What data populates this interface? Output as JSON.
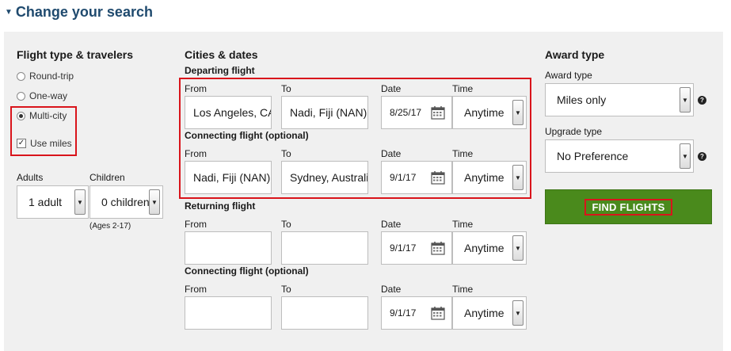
{
  "header": {
    "title": "Change your search"
  },
  "flight_type": {
    "title": "Flight type & travelers",
    "options": [
      {
        "label": "Round-trip",
        "selected": false
      },
      {
        "label": "One-way",
        "selected": false
      },
      {
        "label": "Multi-city",
        "selected": true
      }
    ],
    "use_miles": {
      "label": "Use miles",
      "checked": true
    }
  },
  "travelers": {
    "adults_label": "Adults",
    "adults_value": "1 adult",
    "children_label": "Children",
    "children_value": "0 children",
    "children_note": "(Ages 2-17)"
  },
  "cities": {
    "title": "Cities & dates",
    "col_from": "From",
    "col_to": "To",
    "col_date": "Date",
    "col_time": "Time",
    "segments": [
      {
        "heading": "Departing flight",
        "from": "Los Angeles, CA",
        "to": "Nadi, Fiji (NAN)",
        "date": "8/25/17",
        "time": "Anytime"
      },
      {
        "heading": "Connecting flight (optional)",
        "from": "Nadi, Fiji (NAN)",
        "to": "Sydney, Australia",
        "date": "9/1/17",
        "time": "Anytime"
      },
      {
        "heading": "Returning flight",
        "from": "",
        "to": "",
        "date": "9/1/17",
        "time": "Anytime"
      },
      {
        "heading": "Connecting flight (optional)",
        "from": "",
        "to": "",
        "date": "9/1/17",
        "time": "Anytime"
      }
    ]
  },
  "award": {
    "title": "Award type",
    "award_type_label": "Award type",
    "award_type_value": "Miles only",
    "upgrade_label": "Upgrade type",
    "upgrade_value": "No Preference",
    "find_button": "FIND FLIGHTS",
    "help_glyph": "?"
  },
  "icons": {
    "collapse": "triangle-down-icon",
    "calendar": "calendar-icon",
    "dropdown": "chevron-down-icon",
    "help": "question-icon"
  },
  "colors": {
    "title": "#1f4a6e",
    "accent_red": "#d9141b",
    "button_green": "#4a8a1c",
    "panel_bg": "#f0f0f0"
  }
}
